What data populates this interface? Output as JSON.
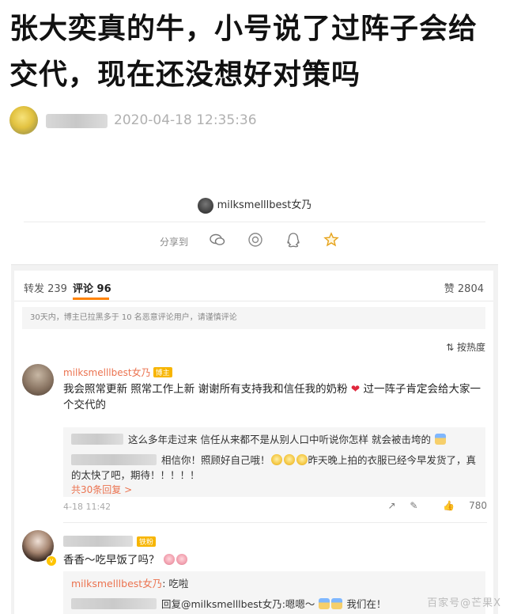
{
  "headline": "张大奕真的牛，小号说了过阵子会给交代，现在还没想好对策吗",
  "author": {
    "time": "2020-04-18 12:35:36"
  },
  "post": {
    "username": "milksmelllbest女乃",
    "share_label": "分享到"
  },
  "tabs": {
    "repost": "转发 239",
    "comment": "评论 96",
    "like": "赞 2804"
  },
  "notice": "30天内，博主已拉黑多于 10 名恶意评论用户，请谨慎评论",
  "sort": "按热度",
  "comment1": {
    "name": "milksmelllbest女乃",
    "level": "博主",
    "text_a": "我会照常更新 照常工作上新 谢谢所有支持我和信任我的奶粉",
    "text_b": " 过一阵子肯定会给大家一个交代的",
    "reply1": "这么多年走过来 信任从来都不是从别人口中听说你怎样 就会被击垮的",
    "reply2_a": "相信你！照顾好自己哦！",
    "reply2_b": "昨天晚上拍的衣服已经今早发货了，真的太快了吧，期待！！！！！",
    "more": "共30条回复 >",
    "time": "4-18 11:42",
    "likes": "780"
  },
  "comment2": {
    "level": "铁粉",
    "text": "香香～吃早饭了吗？",
    "reply1_name": "milksmelllbest女乃",
    "reply1_text": ": 吃啦",
    "reply2_text": "回复@milksmelllbest女乃:嗯嗯～",
    "reply2_tail": "我们在！"
  },
  "watermark": "百家号@芒果X"
}
